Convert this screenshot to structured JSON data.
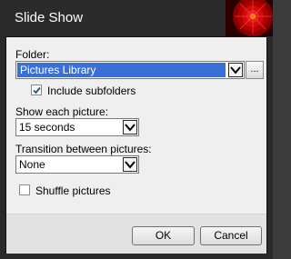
{
  "window": {
    "title": "Slide Show"
  },
  "folder": {
    "label": "Folder:",
    "value": "Pictures Library",
    "browse_label": "..."
  },
  "include_subfolders": {
    "label": "Include subfolders",
    "checked": true
  },
  "show_each": {
    "label": "Show each picture:",
    "value": "15 seconds"
  },
  "transition": {
    "label": "Transition between pictures:",
    "value": "None"
  },
  "shuffle": {
    "label": "Shuffle pictures",
    "checked": false
  },
  "buttons": {
    "ok": "OK",
    "cancel": "Cancel"
  },
  "colors": {
    "selection": "#3a6fd6",
    "title_bar": "#2b2b2b",
    "dialog_bg": "#efefef"
  }
}
